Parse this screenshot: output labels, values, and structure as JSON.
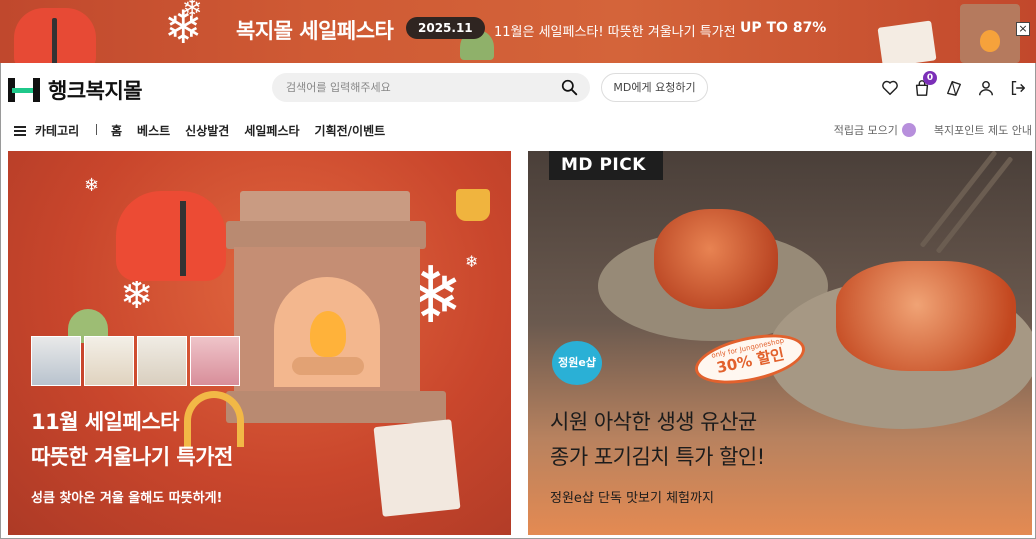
{
  "promo_banner": {
    "title": "복지몰 세일페스타",
    "date_badge": "2025.11",
    "text": "11월은 세일페스타! 따뜻한 겨울나기 특가전",
    "highlight": "UP TO 87%",
    "close_label": "×"
  },
  "header": {
    "logo_text": "행크복지몰",
    "search_placeholder": "검색어를 입력해주세요",
    "md_request_label": "MD에게 요청하기",
    "cart_count": "0"
  },
  "nav": {
    "category_label": "카테고리",
    "links": [
      "홈",
      "베스트",
      "신상발견",
      "세일페스타",
      "기획전/이벤트"
    ],
    "points_label": "적립금 모으기",
    "welfare_guide_label": "복지포인트 제도 안내"
  },
  "cards": [
    {
      "title_line1": "11월 세일페스타",
      "title_line2": "따뜻한 겨울나기 특가전",
      "subtitle": "성큼 찾아온 겨울 올해도 따뜻하게!"
    },
    {
      "badge": "MD PICK",
      "shop_logo": "정원e샵",
      "sale_small": "only for Jungoneshop",
      "sale_big": "30% 할인",
      "title_line1": "시원 아삭한 생생 유산균",
      "title_line2": "종가 포기김치 특가 할인!",
      "subtitle": "정원e샵 단독 맛보기 체험까지"
    }
  ],
  "colors": {
    "promo_bg": "#cf5a34",
    "logo_accent": "#1fc88a",
    "cart_badge": "#7b2fb8",
    "left_card_bg": "#c9462c"
  }
}
